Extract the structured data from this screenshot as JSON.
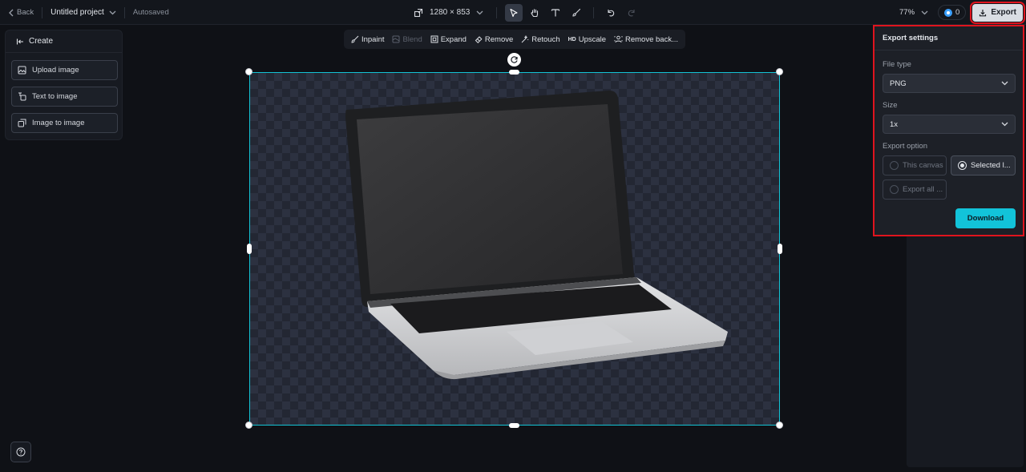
{
  "topbar": {
    "back_label": "Back",
    "project_name": "Untitled project",
    "autosave_status": "Autosaved",
    "canvas_size": "1280 × 853",
    "tools": [
      "select-icon",
      "hand-icon",
      "text-icon",
      "brush-icon"
    ],
    "active_tool": "select",
    "zoom": "77%",
    "credits": "0",
    "export_label": "Export"
  },
  "create_panel": {
    "title": "Create",
    "items": [
      {
        "label": "Upload image",
        "icon": "upload-image-icon"
      },
      {
        "label": "Text to image",
        "icon": "text-to-image-icon"
      },
      {
        "label": "Image to image",
        "icon": "image-to-image-icon"
      }
    ]
  },
  "edit_toolbar": {
    "items": [
      {
        "label": "Inpaint",
        "icon": "inpaint-icon",
        "disabled": false
      },
      {
        "label": "Blend",
        "icon": "blend-icon",
        "disabled": true
      },
      {
        "label": "Expand",
        "icon": "expand-icon",
        "disabled": false
      },
      {
        "label": "Remove",
        "icon": "eraser-icon",
        "disabled": false
      },
      {
        "label": "Retouch",
        "icon": "retouch-icon",
        "disabled": false
      },
      {
        "label": "Upscale",
        "icon": "hd-icon",
        "prefix": "HD",
        "disabled": false
      },
      {
        "label": "Remove back...",
        "icon": "remove-background-icon",
        "disabled": false
      }
    ]
  },
  "export_settings": {
    "title": "Export settings",
    "file_type_label": "File type",
    "file_type_value": "PNG",
    "size_label": "Size",
    "size_value": "1x",
    "export_option_label": "Export option",
    "options": [
      {
        "label": "This canvas",
        "selected": false
      },
      {
        "label": "Selected l...",
        "selected": true
      },
      {
        "label": "Export all ...",
        "selected": false
      }
    ],
    "download_label": "Download"
  },
  "colors": {
    "accent_cyan": "#12c3d9",
    "highlight_red": "#e0141e",
    "background": "#0f1116",
    "panel": "#1d2027"
  }
}
